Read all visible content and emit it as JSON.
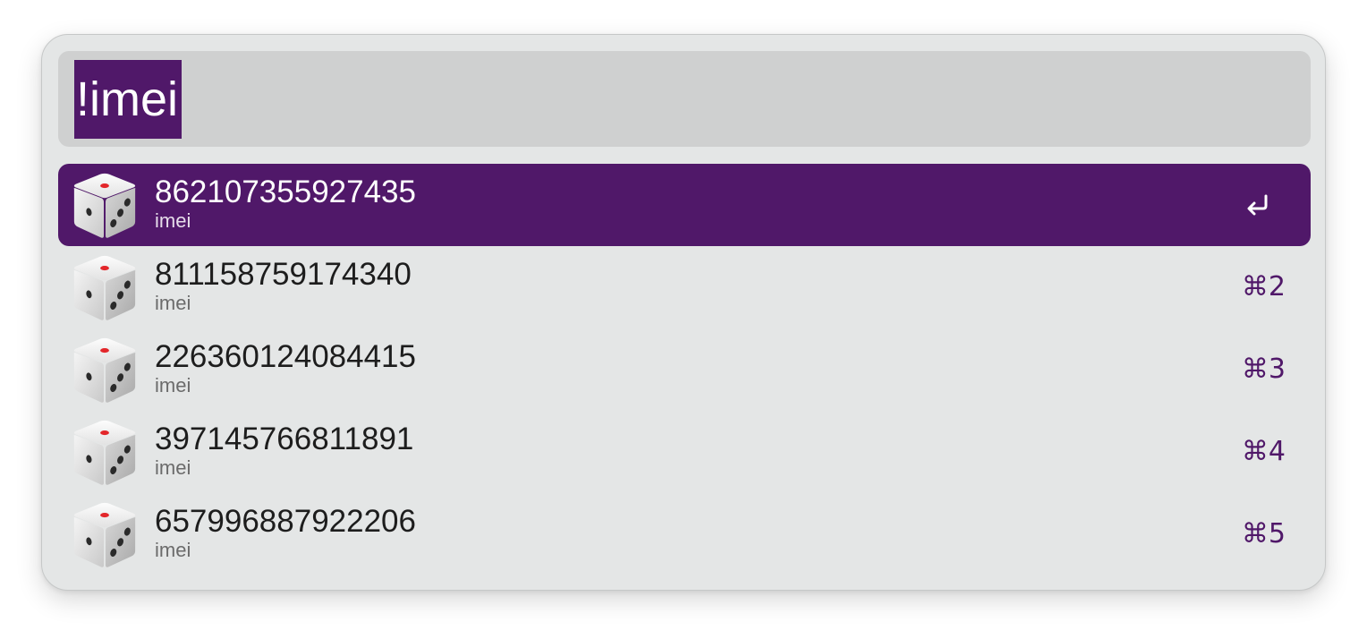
{
  "search": {
    "query": "!imei"
  },
  "results": [
    {
      "title": "862107355927435",
      "subtitle": "imei",
      "shortcut": "",
      "selected": true,
      "icon": "dice-icon"
    },
    {
      "title": "811158759174340",
      "subtitle": "imei",
      "shortcut": "⌘2",
      "selected": false,
      "icon": "dice-icon"
    },
    {
      "title": "226360124084415",
      "subtitle": "imei",
      "shortcut": "⌘3",
      "selected": false,
      "icon": "dice-icon"
    },
    {
      "title": "397145766811891",
      "subtitle": "imei",
      "shortcut": "⌘4",
      "selected": false,
      "icon": "dice-icon"
    },
    {
      "title": "657996887922206",
      "subtitle": "imei",
      "shortcut": "⌘5",
      "selected": false,
      "icon": "dice-icon"
    }
  ],
  "colors": {
    "accent": "#501869",
    "window_bg": "#e4e6e6",
    "search_bg": "#cfd0d0"
  }
}
